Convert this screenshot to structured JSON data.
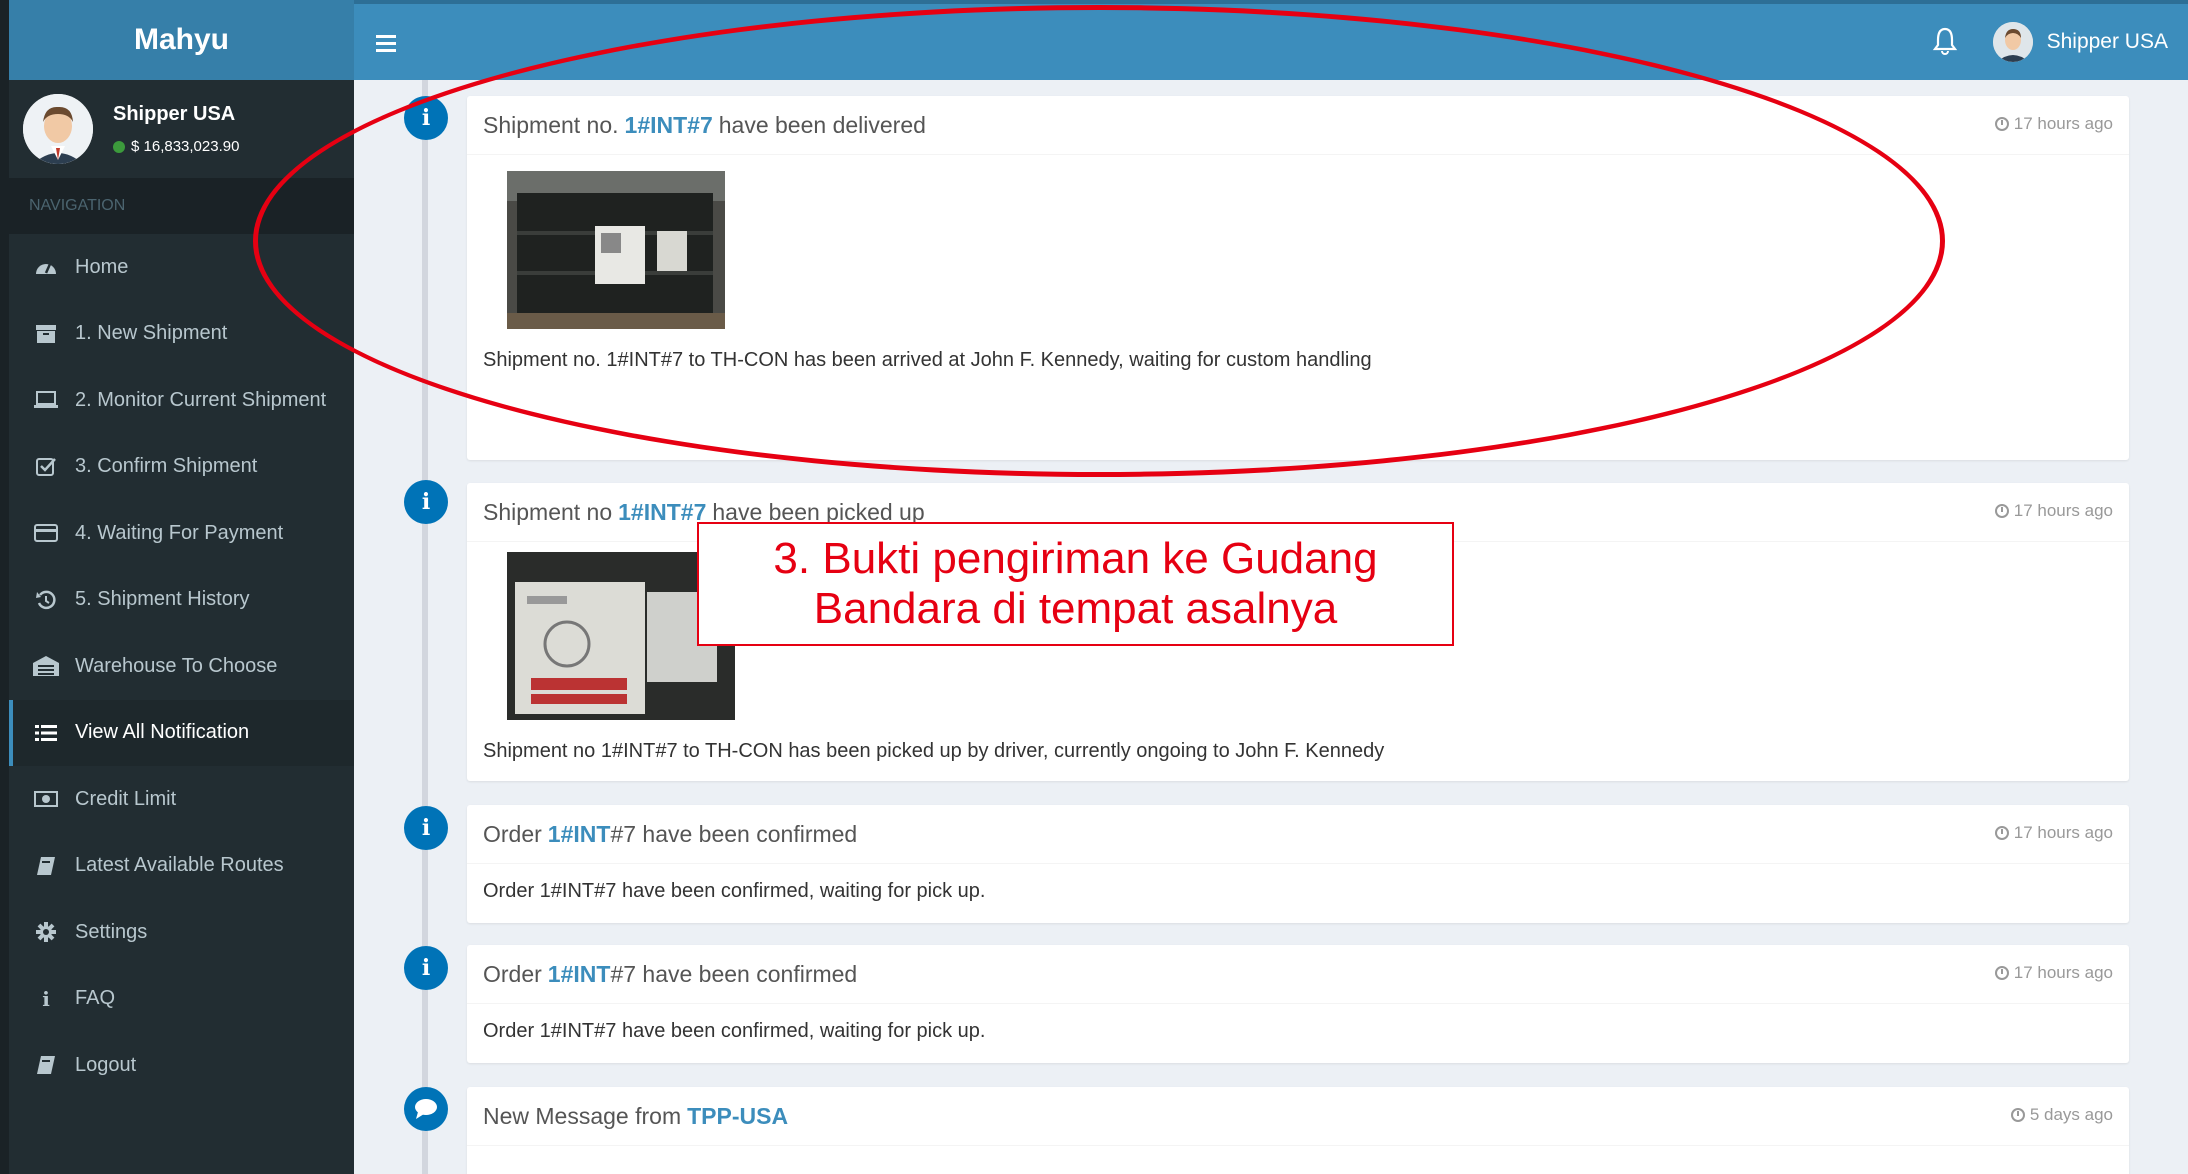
{
  "brand": "Mahyu",
  "user": {
    "name": "Shipper USA",
    "balance": "$ 16,833,023.90"
  },
  "nav": {
    "header": "NAVIGATION",
    "items": [
      {
        "label": "Home",
        "icon": "dashboard-icon"
      },
      {
        "label": "1. New Shipment",
        "icon": "archive-icon"
      },
      {
        "label": "2. Monitor Current Shipment",
        "icon": "laptop-icon"
      },
      {
        "label": "3. Confirm Shipment",
        "icon": "check-square-icon"
      },
      {
        "label": "4. Waiting For Payment",
        "icon": "credit-card-icon"
      },
      {
        "label": "5. Shipment History",
        "icon": "history-icon"
      },
      {
        "label": "Warehouse To Choose",
        "icon": "warehouse-icon"
      },
      {
        "label": "View All Notification",
        "icon": "list-icon"
      },
      {
        "label": "Credit Limit",
        "icon": "money-icon"
      },
      {
        "label": "Latest Available Routes",
        "icon": "book-icon"
      },
      {
        "label": "Settings",
        "icon": "gear-icon"
      },
      {
        "label": "FAQ",
        "icon": "info-icon"
      },
      {
        "label": "Logout",
        "icon": "book-icon"
      }
    ]
  },
  "header": {
    "user_name": "Shipper USA"
  },
  "timeline": [
    {
      "pre": "Shipment no.",
      "ref": "1#INT#7",
      "post": "have been delivered",
      "time": "17 hours ago",
      "body": "Shipment no. 1#INT#7 to TH-CON has been arrived at John F. Kennedy, waiting for custom handling"
    },
    {
      "pre": "Shipment no",
      "ref": "1#INT#7",
      "post": "have been picked up",
      "time": "17 hours ago",
      "body": "Shipment no 1#INT#7 to TH-CON has been picked up by driver, currently ongoing to John F. Kennedy"
    },
    {
      "pre": "Order",
      "ref": "1#INT",
      "post": "#7 have been confirmed",
      "time": "17 hours ago",
      "body": "Order 1#INT#7 have been confirmed, waiting for pick up."
    },
    {
      "pre": "Order",
      "ref": "1#INT",
      "post": "#7 have been confirmed",
      "time": "17 hours ago",
      "body": "Order 1#INT#7 have been confirmed, waiting for pick up."
    },
    {
      "pre": "New Message from",
      "ref": "TPP-USA",
      "post": "",
      "time": "5 days ago"
    }
  ],
  "annotation": {
    "line1": "3. Bukti pengiriman ke Gudang",
    "line2": "Bandara di tempat asalnya"
  },
  "colors": {
    "accent": "#3c8dbc",
    "sidebar": "#222d32",
    "annotation": "#e60012"
  }
}
